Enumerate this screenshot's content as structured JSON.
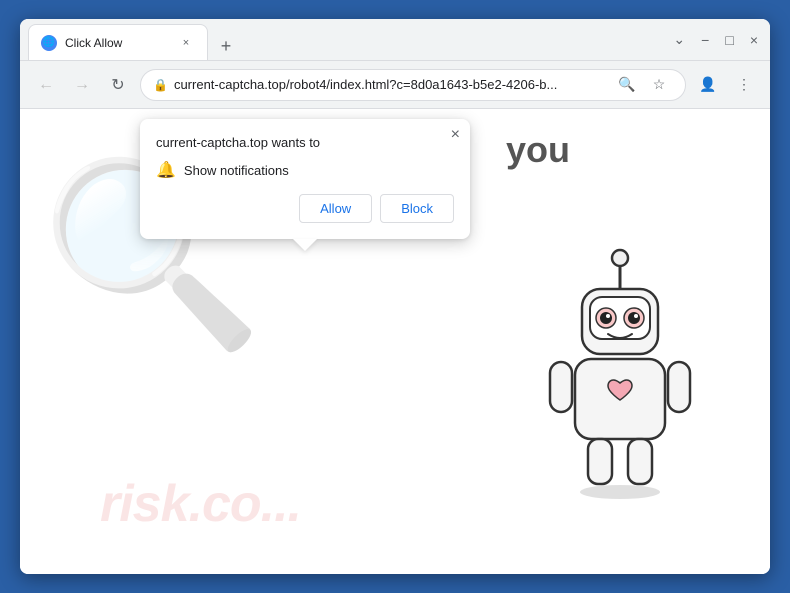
{
  "browser": {
    "tab": {
      "title": "Click Allow",
      "favicon": "🌐"
    },
    "new_tab_icon": "+",
    "window_controls": {
      "minimize": "−",
      "maximize": "□",
      "close": "×"
    },
    "nav": {
      "back": "←",
      "forward": "→",
      "refresh": "↻"
    },
    "url": {
      "lock_icon": "🔒",
      "display": "current-captcha.top/robot4/index.html?c=8d0a1643-b5e2-4206-b...",
      "search_icon": "🔍",
      "bookmark_icon": "☆",
      "profile_icon": "👤",
      "menu_icon": "⋮"
    }
  },
  "page": {
    "you_text": "you",
    "watermark_text": "risk.co..."
  },
  "popup": {
    "title": "current-captcha.top wants to",
    "notification_text": "Show notifications",
    "close_icon": "×",
    "allow_label": "Allow",
    "block_label": "Block"
  }
}
